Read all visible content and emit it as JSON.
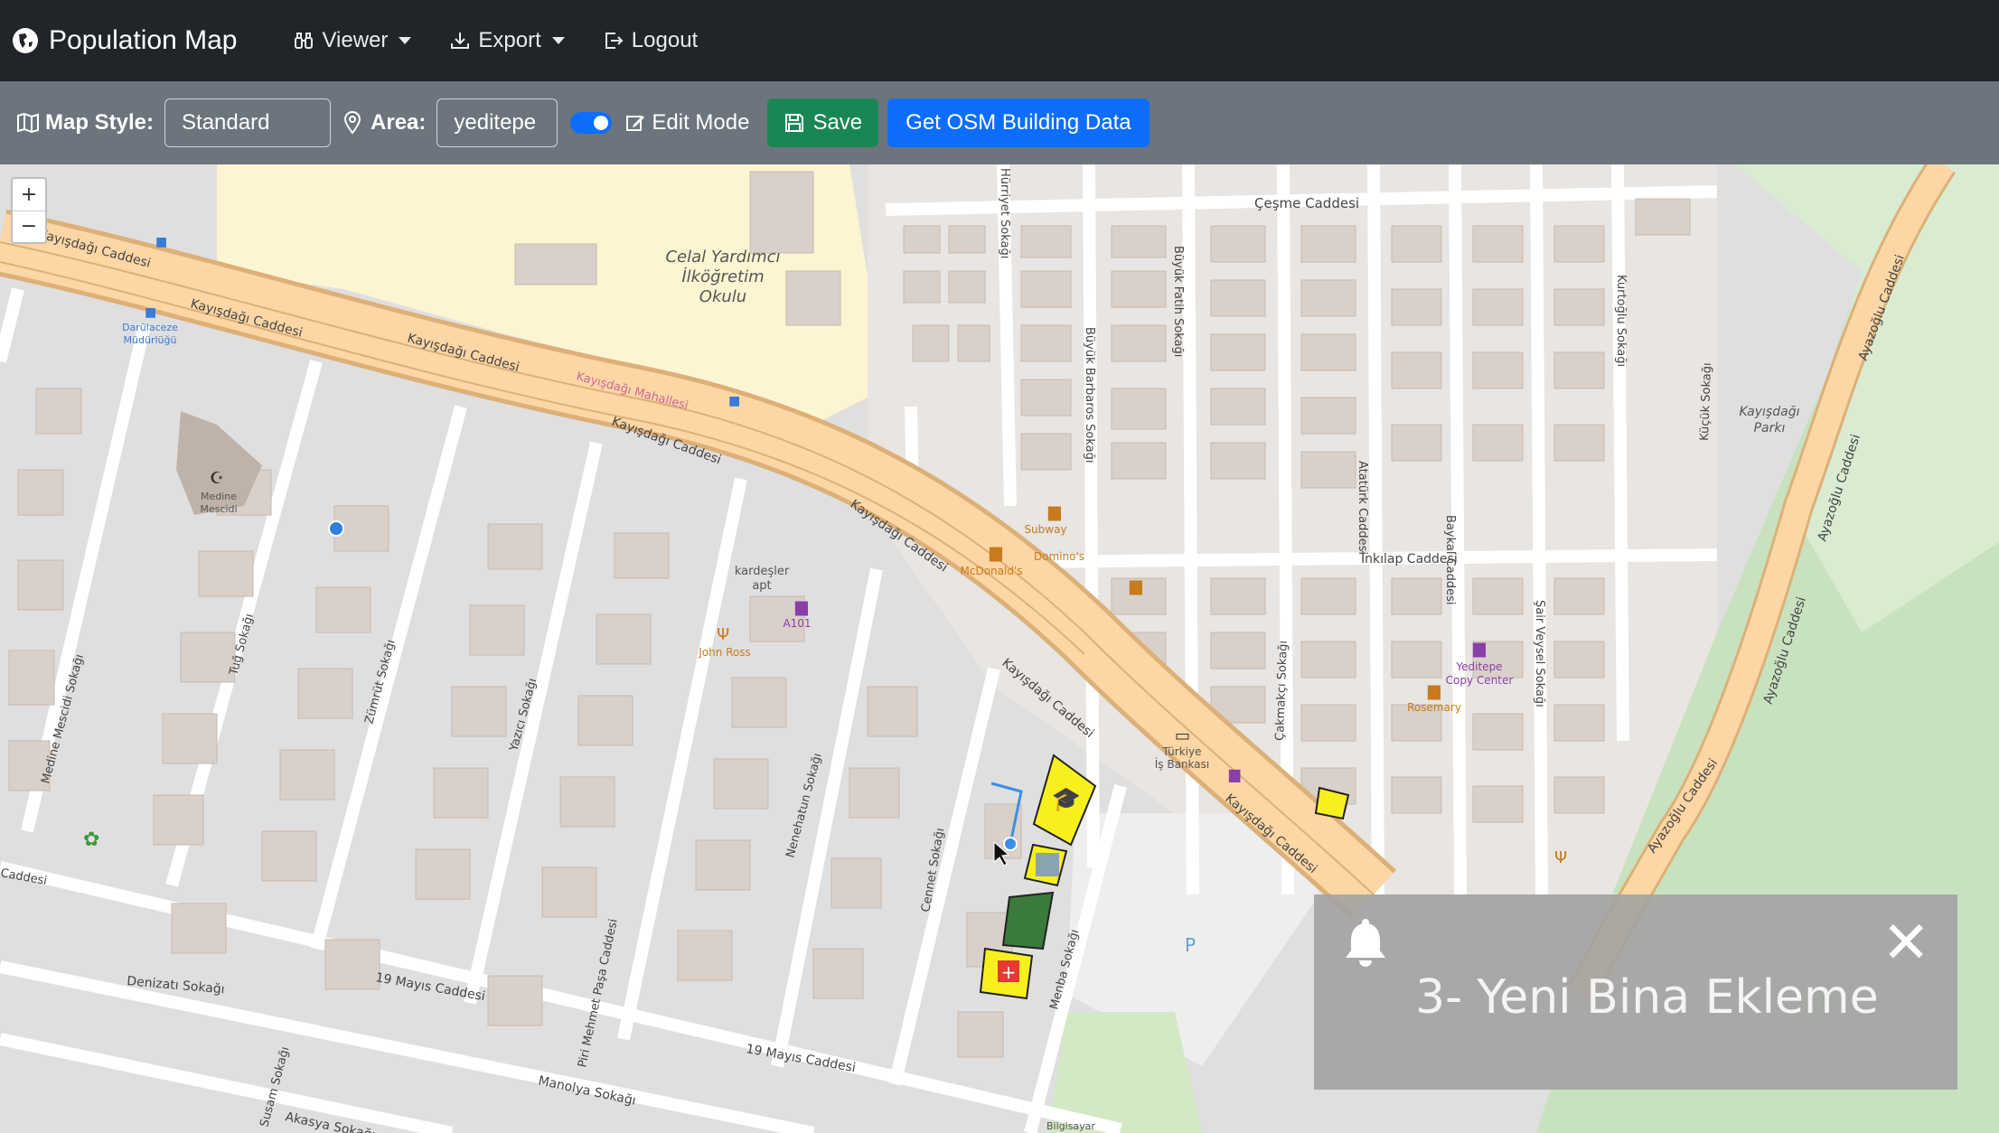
{
  "navbar": {
    "brand": "Population Map",
    "brand_icon": "globe-icon",
    "items": [
      {
        "label": "Viewer",
        "icon": "binoculars-icon",
        "dropdown": true
      },
      {
        "label": "Export",
        "icon": "download-icon",
        "dropdown": true
      },
      {
        "label": "Logout",
        "icon": "logout-icon",
        "dropdown": false
      }
    ],
    "bg_color": "#212529"
  },
  "toolbar": {
    "map_style_label": "Map Style:",
    "map_style_value": "Standard",
    "area_label": "Area:",
    "area_value": "yeditepe",
    "edit_mode_label": "Edit Mode",
    "edit_mode_on": true,
    "save_label": "Save",
    "osm_button_label": "Get OSM Building Data",
    "save_color": "#198754",
    "osm_color": "#0d6efd",
    "bg_color": "#6c757d"
  },
  "map": {
    "zoom_in": "+",
    "zoom_out": "−",
    "labels": {
      "cesme": "Çeşme Caddesi",
      "kayisdagi1": "Kayışdağı Caddesi",
      "kayisdagi2": "Kayışdağı Caddesi",
      "kayisdagi3": "Kayışdağı Caddesi",
      "kayisdagi4": "Kayışdağı Caddesi",
      "kayisdagi5": "Kayışdağı Caddesi",
      "kayisdagi6": "Kayışdağı Caddesi",
      "kayisdagi7": "Kayışdağı Caddesi",
      "kayisdagi_mah": "Kayışdağı Mahallesi",
      "school1": "Celal Yardımcı",
      "school2": "İlköğretim",
      "school3": "Okulu",
      "inkilap": "İnkılap Caddesi",
      "mayis1": "19 Mayıs Caddesi",
      "mayis2": "19 Mayıs Caddesi",
      "denizati": "Denizatı Sokağı",
      "manolya": "Manolya Sokağı",
      "akasya": "Akasya Sokağı",
      "park1": "Kayışdağı",
      "park2": "Parkı",
      "ayazoglu1": "Ayazoğlu Caddesi",
      "ayazoglu2": "Ayazoğlu Caddesi",
      "ayazoglu3": "Ayazoğlu Caddesi",
      "ayazoglu4": "Ayazoğlu Caddesi",
      "mescit1": "Medine",
      "mescit2": "Mescidi",
      "kardesler1": "kardeşler",
      "kardesler2": "apt",
      "a101": "A101",
      "johnross": "John Ross",
      "subway": "Subway",
      "dominos": "Domino's",
      "mcdonalds": "McDonald's",
      "yeditepe_copy1": "Yeditepe",
      "yeditepe_copy2": "Copy Center",
      "turkiye1": "Türkiye",
      "turkiye2": "İş Bankası",
      "rosemary": "Rosemary",
      "daru1": "Darülaceze",
      "daru2": "Müdürlüğü",
      "hurriyet": "Hürriyet Sokağı",
      "buyukfatih": "Büyük Fatih Sokağı",
      "buyukbarbaros": "Büyük Barbaros Sokağı",
      "ataturk": "Atatürk Caddesi",
      "baykal": "Baykal Caddesi",
      "sair": "Şair Veysel Sokağı",
      "kurtoglu": "Kurtoğlu Sokağı",
      "kucuk": "Küçük Sokağı",
      "cakmakci": "Çakmakçı Sokağı",
      "medine_mescidi": "Medine Mescidi Sokağı",
      "tug": "Tuğ Sokağı",
      "zumrut": "Zümrüt Sokağı",
      "yazici": "Yazıcı Sokağı",
      "nenehatun": "Nenehatun Sokağı",
      "cennet": "Cennet Sokağı",
      "menba": "Menba Sokağı",
      "pirimehmet": "Piri Mehmet Paşa Caddesi",
      "susam": "Susam Sokağı",
      "cadde_left": "Caddesi",
      "kayisdagi_tip": "Kayışdağı Caddesi",
      "parking": "P",
      "bilgisayar": "Bilgisayar"
    }
  },
  "toast": {
    "title": "3- Yeni Bina Ekleme",
    "icon": "bell-icon",
    "close": "✕"
  }
}
